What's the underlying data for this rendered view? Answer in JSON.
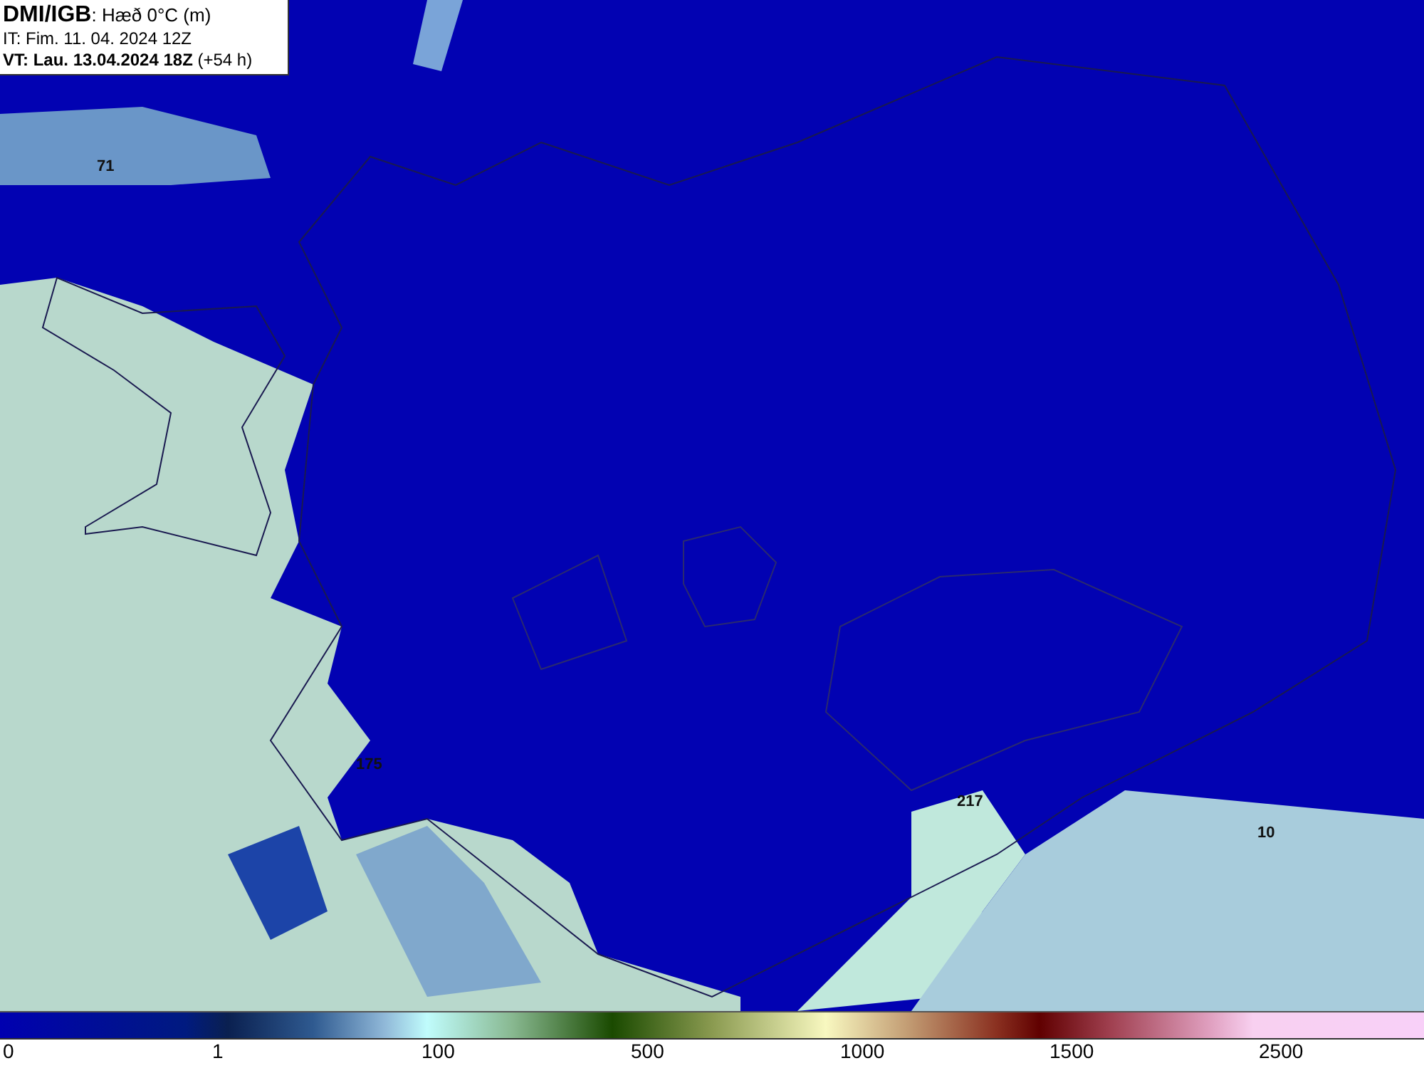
{
  "header": {
    "lines": [
      "**DMI/IGB**: Hæð 0°C (m)",
      "IT: Fim. 11. 04. 2024 12Z",
      "**VT: Lau. 13.04.2024 18Z** (+54 h)"
    ]
  },
  "map": {
    "point_labels": [
      "71",
      "175",
      "217",
      "10"
    ]
  },
  "legend": {
    "ticks": [
      "0",
      "1",
      "100",
      "500",
      "1000",
      "1500",
      "2500"
    ]
  }
}
